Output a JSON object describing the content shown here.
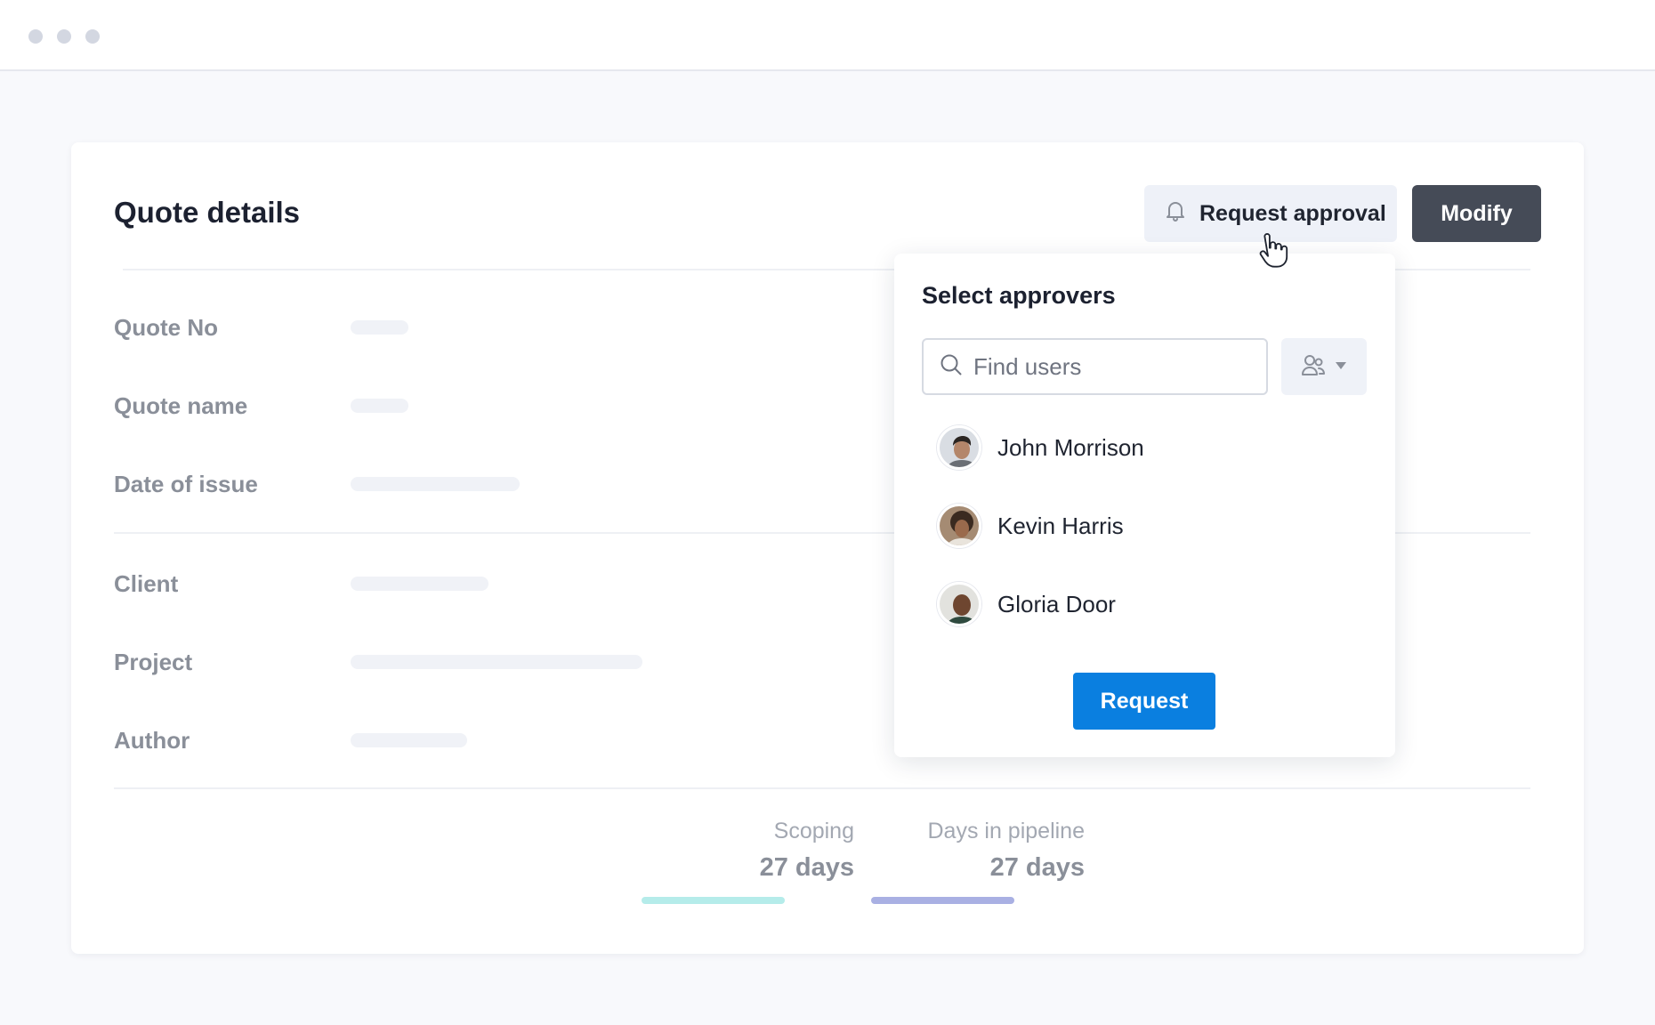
{
  "window": {
    "controls": [
      "close",
      "minimize",
      "maximize"
    ],
    "dot_color": "#d3d7e1"
  },
  "card": {
    "title": "Quote details",
    "actions": {
      "request_approval": {
        "label": "Request approval",
        "icon": "bell-icon"
      },
      "modify": {
        "label": "Modify"
      }
    },
    "fields": [
      {
        "label": "Quote No"
      },
      {
        "label": "Quote name"
      },
      {
        "label": "Date of issue"
      },
      {
        "label": "Client"
      },
      {
        "label": "Project"
      },
      {
        "label": "Author"
      }
    ],
    "metrics": [
      {
        "label": "Scoping",
        "value": "27 days",
        "color": "#b5ecea"
      },
      {
        "label": "Days in pipeline",
        "value": "27 days",
        "color": "#a9b0e3"
      }
    ]
  },
  "popover": {
    "title": "Select approvers",
    "search": {
      "placeholder": "Find users",
      "value": "",
      "icon": "search-icon"
    },
    "filter": {
      "icon": "user-group-icon",
      "chevron": "chevron-down-icon"
    },
    "users": [
      {
        "name": "John Morrison",
        "avatar": "avatar-john-morrison"
      },
      {
        "name": "Kevin Harris",
        "avatar": "avatar-kevin-harris"
      },
      {
        "name": "Gloria Door",
        "avatar": "avatar-gloria-door"
      }
    ],
    "submit": {
      "label": "Request"
    }
  },
  "colors": {
    "accent": "#0a7fe0",
    "modify_button": "#454b57",
    "secondary_button": "#eef1f8"
  }
}
